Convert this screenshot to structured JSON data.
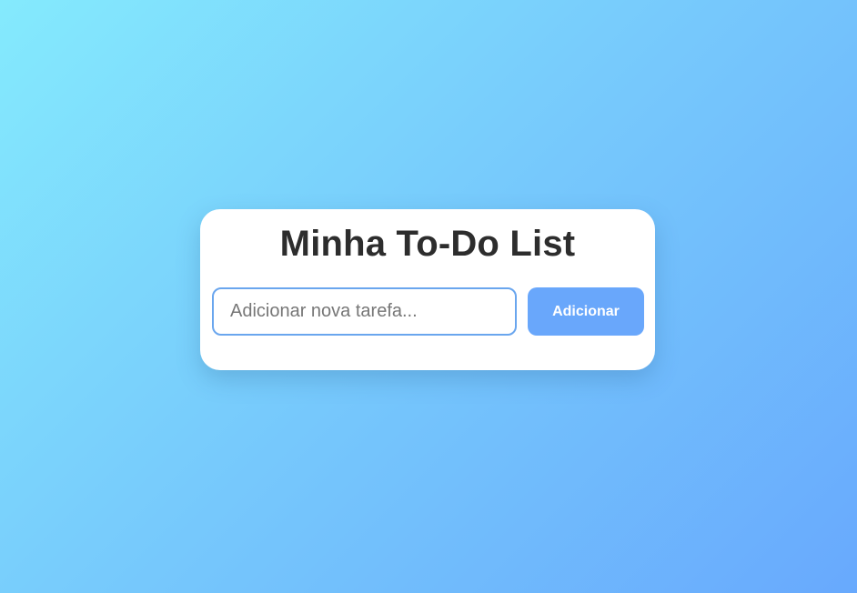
{
  "app": {
    "title": "Minha To-Do List"
  },
  "form": {
    "input_placeholder": "Adicionar nova tarefa...",
    "input_value": "",
    "add_button_label": "Adicionar"
  },
  "tasks": [],
  "colors": {
    "gradient_start": "#84eafd",
    "gradient_end": "#68a9fd",
    "accent": "#69a7fb",
    "input_border": "#6aa6ee",
    "title_text": "#2d2d2d"
  }
}
